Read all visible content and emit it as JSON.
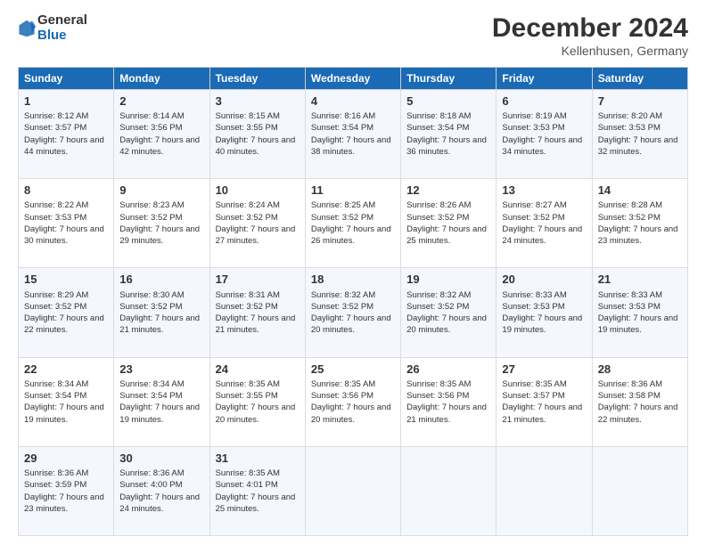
{
  "logo": {
    "general": "General",
    "blue": "Blue"
  },
  "title": "December 2024",
  "subtitle": "Kellenhusen, Germany",
  "headers": [
    "Sunday",
    "Monday",
    "Tuesday",
    "Wednesday",
    "Thursday",
    "Friday",
    "Saturday"
  ],
  "weeks": [
    [
      {
        "day": "1",
        "sunrise": "Sunrise: 8:12 AM",
        "sunset": "Sunset: 3:57 PM",
        "daylight": "Daylight: 7 hours and 44 minutes."
      },
      {
        "day": "2",
        "sunrise": "Sunrise: 8:14 AM",
        "sunset": "Sunset: 3:56 PM",
        "daylight": "Daylight: 7 hours and 42 minutes."
      },
      {
        "day": "3",
        "sunrise": "Sunrise: 8:15 AM",
        "sunset": "Sunset: 3:55 PM",
        "daylight": "Daylight: 7 hours and 40 minutes."
      },
      {
        "day": "4",
        "sunrise": "Sunrise: 8:16 AM",
        "sunset": "Sunset: 3:54 PM",
        "daylight": "Daylight: 7 hours and 38 minutes."
      },
      {
        "day": "5",
        "sunrise": "Sunrise: 8:18 AM",
        "sunset": "Sunset: 3:54 PM",
        "daylight": "Daylight: 7 hours and 36 minutes."
      },
      {
        "day": "6",
        "sunrise": "Sunrise: 8:19 AM",
        "sunset": "Sunset: 3:53 PM",
        "daylight": "Daylight: 7 hours and 34 minutes."
      },
      {
        "day": "7",
        "sunrise": "Sunrise: 8:20 AM",
        "sunset": "Sunset: 3:53 PM",
        "daylight": "Daylight: 7 hours and 32 minutes."
      }
    ],
    [
      {
        "day": "8",
        "sunrise": "Sunrise: 8:22 AM",
        "sunset": "Sunset: 3:53 PM",
        "daylight": "Daylight: 7 hours and 30 minutes."
      },
      {
        "day": "9",
        "sunrise": "Sunrise: 8:23 AM",
        "sunset": "Sunset: 3:52 PM",
        "daylight": "Daylight: 7 hours and 29 minutes."
      },
      {
        "day": "10",
        "sunrise": "Sunrise: 8:24 AM",
        "sunset": "Sunset: 3:52 PM",
        "daylight": "Daylight: 7 hours and 27 minutes."
      },
      {
        "day": "11",
        "sunrise": "Sunrise: 8:25 AM",
        "sunset": "Sunset: 3:52 PM",
        "daylight": "Daylight: 7 hours and 26 minutes."
      },
      {
        "day": "12",
        "sunrise": "Sunrise: 8:26 AM",
        "sunset": "Sunset: 3:52 PM",
        "daylight": "Daylight: 7 hours and 25 minutes."
      },
      {
        "day": "13",
        "sunrise": "Sunrise: 8:27 AM",
        "sunset": "Sunset: 3:52 PM",
        "daylight": "Daylight: 7 hours and 24 minutes."
      },
      {
        "day": "14",
        "sunrise": "Sunrise: 8:28 AM",
        "sunset": "Sunset: 3:52 PM",
        "daylight": "Daylight: 7 hours and 23 minutes."
      }
    ],
    [
      {
        "day": "15",
        "sunrise": "Sunrise: 8:29 AM",
        "sunset": "Sunset: 3:52 PM",
        "daylight": "Daylight: 7 hours and 22 minutes."
      },
      {
        "day": "16",
        "sunrise": "Sunrise: 8:30 AM",
        "sunset": "Sunset: 3:52 PM",
        "daylight": "Daylight: 7 hours and 21 minutes."
      },
      {
        "day": "17",
        "sunrise": "Sunrise: 8:31 AM",
        "sunset": "Sunset: 3:52 PM",
        "daylight": "Daylight: 7 hours and 21 minutes."
      },
      {
        "day": "18",
        "sunrise": "Sunrise: 8:32 AM",
        "sunset": "Sunset: 3:52 PM",
        "daylight": "Daylight: 7 hours and 20 minutes."
      },
      {
        "day": "19",
        "sunrise": "Sunrise: 8:32 AM",
        "sunset": "Sunset: 3:52 PM",
        "daylight": "Daylight: 7 hours and 20 minutes."
      },
      {
        "day": "20",
        "sunrise": "Sunrise: 8:33 AM",
        "sunset": "Sunset: 3:53 PM",
        "daylight": "Daylight: 7 hours and 19 minutes."
      },
      {
        "day": "21",
        "sunrise": "Sunrise: 8:33 AM",
        "sunset": "Sunset: 3:53 PM",
        "daylight": "Daylight: 7 hours and 19 minutes."
      }
    ],
    [
      {
        "day": "22",
        "sunrise": "Sunrise: 8:34 AM",
        "sunset": "Sunset: 3:54 PM",
        "daylight": "Daylight: 7 hours and 19 minutes."
      },
      {
        "day": "23",
        "sunrise": "Sunrise: 8:34 AM",
        "sunset": "Sunset: 3:54 PM",
        "daylight": "Daylight: 7 hours and 19 minutes."
      },
      {
        "day": "24",
        "sunrise": "Sunrise: 8:35 AM",
        "sunset": "Sunset: 3:55 PM",
        "daylight": "Daylight: 7 hours and 20 minutes."
      },
      {
        "day": "25",
        "sunrise": "Sunrise: 8:35 AM",
        "sunset": "Sunset: 3:56 PM",
        "daylight": "Daylight: 7 hours and 20 minutes."
      },
      {
        "day": "26",
        "sunrise": "Sunrise: 8:35 AM",
        "sunset": "Sunset: 3:56 PM",
        "daylight": "Daylight: 7 hours and 21 minutes."
      },
      {
        "day": "27",
        "sunrise": "Sunrise: 8:35 AM",
        "sunset": "Sunset: 3:57 PM",
        "daylight": "Daylight: 7 hours and 21 minutes."
      },
      {
        "day": "28",
        "sunrise": "Sunrise: 8:36 AM",
        "sunset": "Sunset: 3:58 PM",
        "daylight": "Daylight: 7 hours and 22 minutes."
      }
    ],
    [
      {
        "day": "29",
        "sunrise": "Sunrise: 8:36 AM",
        "sunset": "Sunset: 3:59 PM",
        "daylight": "Daylight: 7 hours and 23 minutes."
      },
      {
        "day": "30",
        "sunrise": "Sunrise: 8:36 AM",
        "sunset": "Sunset: 4:00 PM",
        "daylight": "Daylight: 7 hours and 24 minutes."
      },
      {
        "day": "31",
        "sunrise": "Sunrise: 8:35 AM",
        "sunset": "Sunset: 4:01 PM",
        "daylight": "Daylight: 7 hours and 25 minutes."
      },
      null,
      null,
      null,
      null
    ]
  ]
}
